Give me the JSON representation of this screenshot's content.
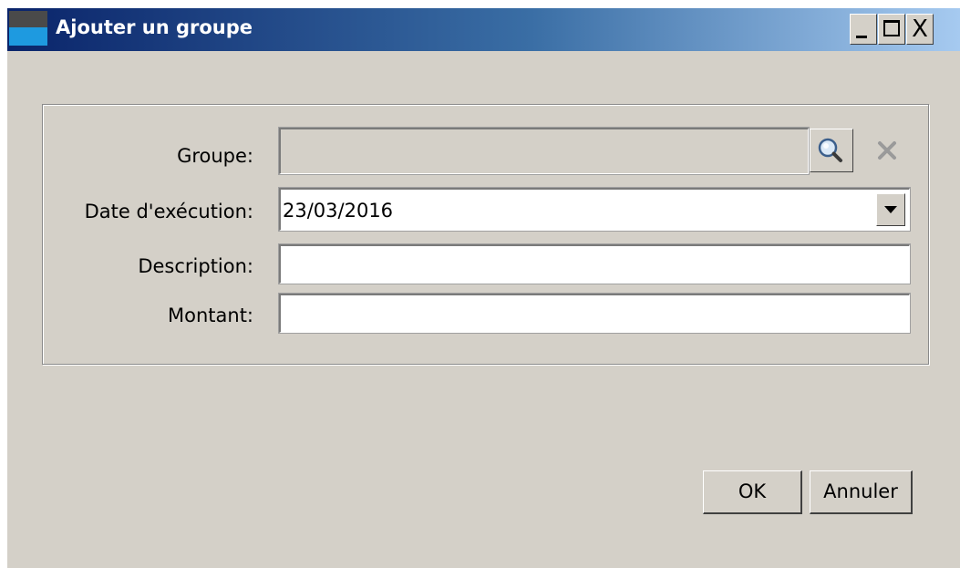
{
  "window": {
    "title": "Ajouter un groupe",
    "controls": {
      "close_symbol": "X"
    }
  },
  "form": {
    "groupe": {
      "label": "Groupe:",
      "value": "",
      "search_icon": "magnifier-icon",
      "clear_icon": "clear-x-icon"
    },
    "date_execution": {
      "label": "Date d'exécution:",
      "value": "23/03/2016",
      "dropdown_icon": "chevron-down-icon"
    },
    "description": {
      "label": "Description:",
      "value": ""
    },
    "montant": {
      "label": "Montant:",
      "value": ""
    }
  },
  "buttons": {
    "ok_label": "OK",
    "cancel_label": "Annuler"
  },
  "colors": {
    "title_gradient_start": "#0a246a",
    "title_gradient_end": "#a6caf0",
    "window_background": "#d4d0c8",
    "field_background": "#ffffff"
  }
}
